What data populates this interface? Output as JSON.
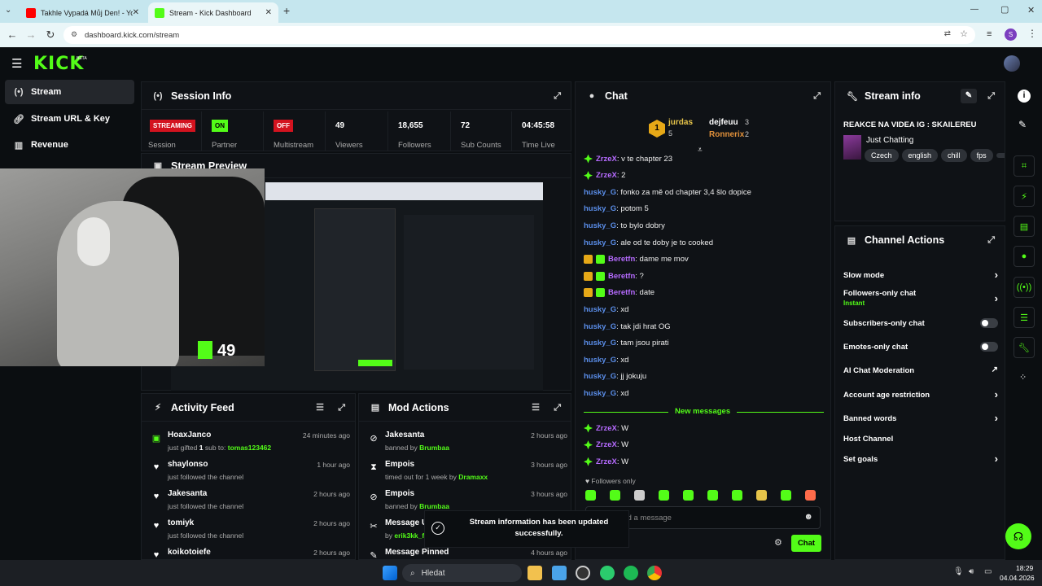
{
  "browser": {
    "tabs": [
      {
        "title": "Takhle Vypadá Můj Den! - YouT…",
        "active": false
      },
      {
        "title": "Stream - Kick Dashboard",
        "active": true
      }
    ],
    "new_tab": "+",
    "url": "dashboard.kick.com/stream",
    "profile_initial": "S",
    "window_controls": {
      "minimize": "—",
      "maximize": "▢",
      "close": "✕"
    }
  },
  "kick": {
    "logo": "KICK",
    "logo_beta": "BETA"
  },
  "sidebar": {
    "items": [
      {
        "label": "Stream",
        "icon": "broadcast-icon",
        "active": true
      },
      {
        "label": "Stream URL & Key",
        "icon": "link-icon",
        "active": false
      },
      {
        "label": "Revenue",
        "icon": "chart-icon",
        "active": false
      }
    ]
  },
  "session_info": {
    "title": "Session Info",
    "stats": [
      {
        "value": "STREAMING",
        "label": "Session",
        "style": "red"
      },
      {
        "value": "ON",
        "label": "Partner",
        "style": "green"
      },
      {
        "value": "OFF",
        "label": "Multistream",
        "style": "red"
      },
      {
        "value": "49",
        "label": "Viewers"
      },
      {
        "value": "18,655",
        "label": "Followers"
      },
      {
        "value": "72",
        "label": "Sub Counts"
      },
      {
        "value": "04:45:58",
        "label": "Time Live"
      }
    ]
  },
  "stream_preview": {
    "title": "Stream Preview",
    "viewer_count": "49"
  },
  "activity_feed": {
    "title": "Activity Feed",
    "items": [
      {
        "name": "HoaxJanco",
        "sub_prefix": "just gifted ",
        "sub_count": "1",
        "sub_mid": " sub to: ",
        "sub_target": "tomas123462",
        "time": "24 minutes ago",
        "icon": "gift-icon"
      },
      {
        "name": "shaylonso",
        "sub": "just followed the channel",
        "time": "1 hour ago",
        "icon": "heart-icon"
      },
      {
        "name": "Jakesanta",
        "sub": "just followed the channel",
        "time": "2 hours ago",
        "icon": "heart-icon"
      },
      {
        "name": "tomiyk",
        "sub": "just followed the channel",
        "time": "2 hours ago",
        "icon": "heart-icon"
      },
      {
        "name": "koikotoiefe",
        "sub": "",
        "time": "2 hours ago",
        "icon": "heart-icon"
      }
    ]
  },
  "mod_actions": {
    "title": "Mod Actions",
    "items": [
      {
        "name": "Jakesanta",
        "sub": "banned by ",
        "by": "Brumbaa",
        "time": "2 hours ago",
        "icon": "ban-icon"
      },
      {
        "name": "Empois",
        "sub": "timed out for 1 week by ",
        "by": "Dramaxx",
        "time": "3 hours ago",
        "icon": "hourglass-icon"
      },
      {
        "name": "Empois",
        "sub": "banned by ",
        "by": "Brumbaa",
        "time": "3 hours ago",
        "icon": "ban-icon"
      },
      {
        "name": "Message U",
        "sub": "by ",
        "by": "erik3kk_fr",
        "time": "",
        "icon": "unpin-icon"
      },
      {
        "name": "Message Pinned",
        "sub": "",
        "by": "",
        "time": "4 hours ago",
        "icon": "pin-icon"
      }
    ]
  },
  "chat": {
    "title": "Chat",
    "leaderboard": {
      "rank": "1",
      "first": {
        "name": "jurdas",
        "count": "5"
      },
      "second": {
        "name": "dejfeuu",
        "count": "3"
      },
      "third": {
        "name": "Ronnerix",
        "count": "2"
      }
    },
    "messages": [
      {
        "user": "ZrzeX",
        "color": "purple",
        "text": ": v te chapter 23",
        "badges": [
          "diamond"
        ]
      },
      {
        "user": "ZrzeX",
        "color": "purple",
        "text": ": 2",
        "badges": [
          "diamond"
        ]
      },
      {
        "user": "husky_G",
        "color": "blue",
        "text": ": fonko za mě od chapter 3,4 šlo dopice",
        "badges": []
      },
      {
        "user": "husky_G",
        "color": "blue",
        "text": ": potom 5",
        "badges": []
      },
      {
        "user": "husky_G",
        "color": "blue",
        "text": ": to bylo dobry",
        "badges": []
      },
      {
        "user": "husky_G",
        "color": "blue",
        "text": ": ale od te doby je to cooked",
        "badges": []
      },
      {
        "user": "Beretfn",
        "color": "purple",
        "text": ": dame me mov",
        "badges": [
          "crown",
          "gift"
        ]
      },
      {
        "user": "Beretfn",
        "color": "purple",
        "text": ": ?",
        "badges": [
          "crown",
          "gift"
        ]
      },
      {
        "user": "Beretfn",
        "color": "purple",
        "text": ": date",
        "badges": [
          "crown",
          "gift"
        ]
      },
      {
        "user": "husky_G",
        "color": "blue",
        "text": ": xd",
        "badges": []
      },
      {
        "user": "husky_G",
        "color": "blue",
        "text": ": tak jdi hrat OG",
        "badges": []
      },
      {
        "user": "husky_G",
        "color": "blue",
        "text": ": tam jsou pirati",
        "badges": []
      },
      {
        "user": "husky_G",
        "color": "blue",
        "text": ": xd",
        "badges": []
      },
      {
        "user": "husky_G",
        "color": "blue",
        "text": ": jj jokuju",
        "badges": []
      },
      {
        "user": "husky_G",
        "color": "blue",
        "text": ": xd",
        "badges": []
      }
    ],
    "new_messages_label": "New messages",
    "new_messages": [
      {
        "user": "ZrzeX",
        "color": "purple",
        "text": ": W"
      },
      {
        "user": "ZrzeX",
        "color": "purple",
        "text": ": W"
      },
      {
        "user": "ZrzeX",
        "color": "purple",
        "text": ": W"
      }
    ],
    "followers_only": "Followers only",
    "input_placeholder": "end a message",
    "send_label": "Chat"
  },
  "toast": {
    "message": "Stream information has been updated successfully."
  },
  "stream_info": {
    "title": "Stream info",
    "stream_title": "REAKCE NA VIDEA IG : SKAILEREU",
    "category": "Just Chatting",
    "tags": [
      "Czech",
      "english",
      "chill",
      "fps"
    ]
  },
  "channel_actions": {
    "title": "Channel Actions",
    "rows": [
      {
        "label": "Slow mode",
        "type": "chevron"
      },
      {
        "label": "Followers-only chat",
        "sub": "Instant",
        "type": "chevron"
      },
      {
        "label": "Subscribers-only chat",
        "type": "toggle"
      },
      {
        "label": "Emotes-only chat",
        "type": "toggle"
      },
      {
        "label": "AI Chat Moderation",
        "type": "external"
      },
      {
        "label": "Account age restriction",
        "type": "chevron"
      },
      {
        "label": "Banned words",
        "type": "chevron"
      },
      {
        "label": "Host Channel",
        "type": "none"
      },
      {
        "label": "Set goals",
        "type": "chevron"
      }
    ]
  },
  "taskbar": {
    "search_placeholder": "Hledat",
    "time": "18:29",
    "date": "04.04.2026"
  },
  "colors": {
    "kick_green": "#53fc18",
    "badge_red": "#d3131f",
    "panel_bg": "#0f1216",
    "page_bg": "#0b0e11"
  }
}
